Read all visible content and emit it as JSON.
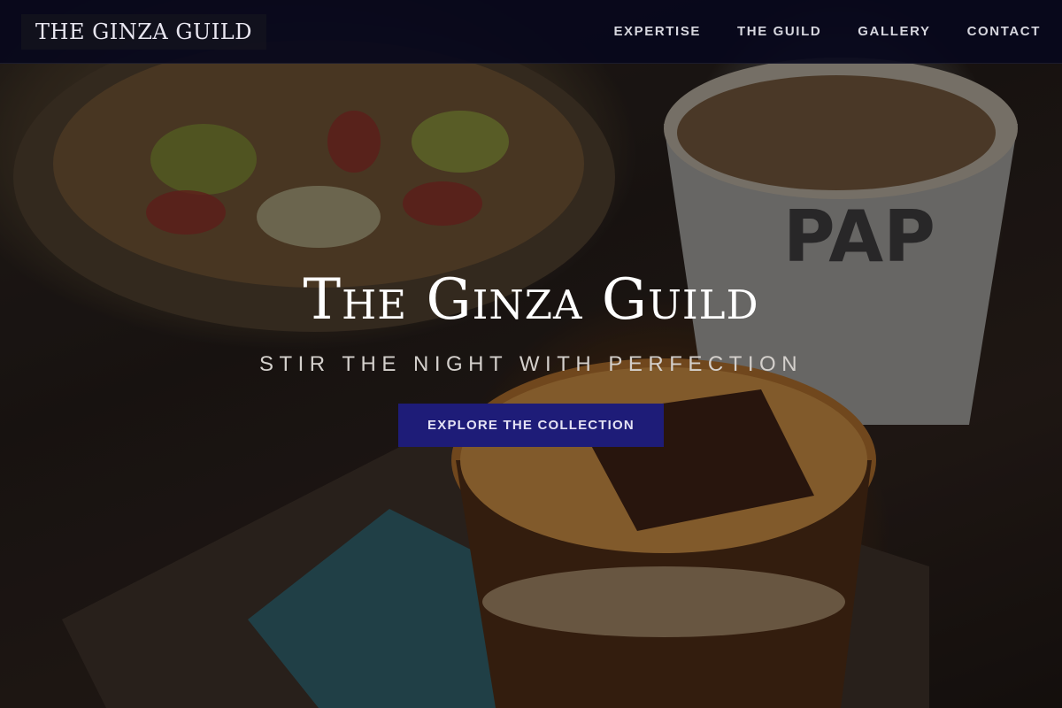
{
  "header": {
    "brand": "THE GINZA GUILD",
    "nav": [
      {
        "label": "EXPERTISE"
      },
      {
        "label": "THE GUILD"
      },
      {
        "label": "GALLERY"
      },
      {
        "label": "CONTACT"
      }
    ]
  },
  "hero": {
    "title": "The Ginza Guild",
    "tagline": "STIR THE NIGHT WITH PERFECTION",
    "cta_label": "EXPLORE THE COLLECTION"
  },
  "colors": {
    "navbar_bg": "#08081c",
    "cta_bg": "#1e1c78",
    "title_text": "#ffffff"
  }
}
